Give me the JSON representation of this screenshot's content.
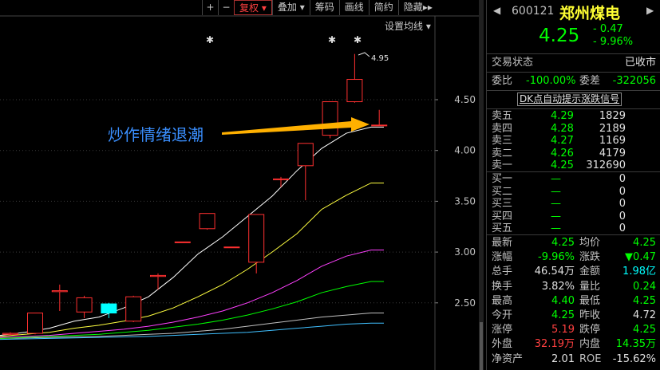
{
  "toolbar": {
    "plus": "+",
    "minus": "−",
    "fuquan": "复权",
    "diejia": "叠加",
    "chouma": "筹码",
    "huaxian": "画线",
    "jiangchou": "简约",
    "yincang": "隐藏"
  },
  "ma_setting": "设置均线",
  "annotation": "炒作情绪退潮",
  "high_label": "4.95",
  "y_axis_ticks": [
    "4.50",
    "4.00",
    "3.50",
    "3.00",
    "2.50"
  ],
  "colors": {
    "up": "#ff3030",
    "down": "#00ffff",
    "arrow": "#ffb000",
    "annotation": "#3a8fff",
    "ma5": "#ffffff",
    "ma10": "#ffff40",
    "ma20": "#ff40ff",
    "ma30": "#00ff00",
    "ma60": "#c0c0c0",
    "ma120": "#40c0ff"
  },
  "stock": {
    "code": "600121",
    "name": "郑州煤电",
    "price": "4.25",
    "change": "- 0.47",
    "change_pct": "- 9.96%"
  },
  "status": {
    "label": "交易状态",
    "value": "已收市"
  },
  "weibi": {
    "label": "委比",
    "value": "-100.00%",
    "label2": "委差",
    "value2": "-322056"
  },
  "dk_signal": "DK点自动提示涨跌信号",
  "sell": [
    {
      "label": "卖五",
      "price": "4.29",
      "vol": "1829"
    },
    {
      "label": "卖四",
      "price": "4.28",
      "vol": "2189"
    },
    {
      "label": "卖三",
      "price": "4.27",
      "vol": "1169"
    },
    {
      "label": "卖二",
      "price": "4.26",
      "vol": "4179"
    },
    {
      "label": "卖一",
      "price": "4.25",
      "vol": "312690"
    }
  ],
  "buy": [
    {
      "label": "买一",
      "price": "—",
      "vol": "0"
    },
    {
      "label": "买二",
      "price": "—",
      "vol": "0"
    },
    {
      "label": "买三",
      "price": "—",
      "vol": "0"
    },
    {
      "label": "买四",
      "price": "—",
      "vol": "0"
    },
    {
      "label": "买五",
      "price": "—",
      "vol": "0"
    }
  ],
  "stats": [
    {
      "l1": "最新",
      "v1": "4.25",
      "c1": "g",
      "l2": "均价",
      "v2": "4.25",
      "c2": "g"
    },
    {
      "l1": "涨幅",
      "v1": "-9.96%",
      "c1": "g",
      "l2": "涨跌",
      "v2": "▼0.47",
      "c2": "g"
    },
    {
      "l1": "总手",
      "v1": "46.54万",
      "c1": "w",
      "l2": "金额",
      "v2": "1.98亿",
      "c2": "c"
    },
    {
      "l1": "换手",
      "v1": "3.82%",
      "c1": "w",
      "l2": "量比",
      "v2": "0.24",
      "c2": "g"
    },
    {
      "l1": "最高",
      "v1": "4.40",
      "c1": "g",
      "l2": "最低",
      "v2": "4.25",
      "c2": "g"
    },
    {
      "l1": "今开",
      "v1": "4.25",
      "c1": "g",
      "l2": "昨收",
      "v2": "4.72",
      "c2": "w"
    },
    {
      "l1": "涨停",
      "v1": "5.19",
      "c1": "rd",
      "l2": "跌停",
      "v2": "4.25",
      "c2": "g"
    },
    {
      "l1": "外盘",
      "v1": "32.19万",
      "c1": "rd",
      "l2": "内盘",
      "v2": "14.35万",
      "c2": "g"
    },
    {
      "l1": "净资产",
      "v1": "2.01",
      "c1": "w",
      "l2": "ROE",
      "v2": "-15.62%",
      "c2": "w"
    }
  ],
  "chart_data": {
    "type": "candlestick",
    "candles": [
      {
        "o": 2.19,
        "c": 2.2,
        "h": 2.21,
        "l": 2.18
      },
      {
        "o": 2.2,
        "c": 2.4,
        "h": 2.4,
        "l": 2.19
      },
      {
        "o": 2.61,
        "c": 2.62,
        "h": 2.68,
        "l": 2.42
      },
      {
        "o": 2.41,
        "c": 2.55,
        "h": 2.57,
        "l": 2.35
      },
      {
        "o": 2.49,
        "c": 2.4,
        "h": 2.5,
        "l": 2.35
      },
      {
        "o": 2.32,
        "c": 2.56,
        "h": 2.57,
        "l": 2.31
      },
      {
        "o": 2.76,
        "c": 2.77,
        "h": 2.79,
        "l": 2.63
      },
      {
        "o": 3.1,
        "c": 3.1,
        "h": 3.1,
        "l": 3.1
      },
      {
        "o": 3.23,
        "c": 3.38,
        "h": 3.38,
        "l": 3.22
      },
      {
        "o": 3.05,
        "c": 3.05,
        "h": 3.05,
        "l": 3.05
      },
      {
        "o": 2.9,
        "c": 3.37,
        "h": 3.37,
        "l": 2.79
      },
      {
        "o": 3.72,
        "c": 3.72,
        "h": 3.74,
        "l": 3.64
      },
      {
        "o": 3.85,
        "c": 4.07,
        "h": 4.07,
        "l": 3.51
      },
      {
        "o": 4.15,
        "c": 4.48,
        "h": 4.48,
        "l": 4.12
      },
      {
        "o": 4.48,
        "c": 4.7,
        "h": 4.95,
        "l": 4.47
      },
      {
        "o": 4.25,
        "c": 4.25,
        "h": 4.4,
        "l": 4.25
      }
    ],
    "ma5": [
      2.18,
      2.21,
      2.25,
      2.32,
      2.36,
      2.45,
      2.56,
      2.75,
      2.98,
      3.15,
      3.35,
      3.55,
      3.8,
      4.02,
      4.17,
      4.23
    ],
    "ma10": [
      2.17,
      2.19,
      2.21,
      2.25,
      2.28,
      2.32,
      2.37,
      2.45,
      2.56,
      2.68,
      2.83,
      3.0,
      3.18,
      3.42,
      3.56,
      3.68
    ],
    "ma20": [
      2.16,
      2.17,
      2.18,
      2.2,
      2.22,
      2.24,
      2.27,
      2.31,
      2.36,
      2.42,
      2.5,
      2.6,
      2.72,
      2.86,
      2.96,
      3.02
    ],
    "ma30": [
      2.15,
      2.16,
      2.17,
      2.18,
      2.19,
      2.21,
      2.23,
      2.26,
      2.29,
      2.33,
      2.38,
      2.44,
      2.51,
      2.6,
      2.66,
      2.71
    ],
    "ma60": [
      2.15,
      2.155,
      2.16,
      2.165,
      2.17,
      2.18,
      2.19,
      2.2,
      2.22,
      2.24,
      2.27,
      2.3,
      2.33,
      2.36,
      2.38,
      2.4
    ],
    "ma120": [
      2.14,
      2.145,
      2.15,
      2.155,
      2.16,
      2.165,
      2.17,
      2.18,
      2.19,
      2.2,
      2.21,
      2.23,
      2.25,
      2.27,
      2.29,
      2.3
    ]
  }
}
